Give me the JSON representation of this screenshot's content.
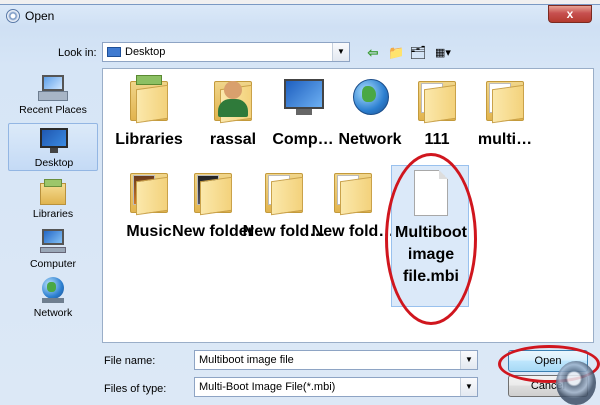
{
  "window": {
    "title": "Open",
    "close_label": "x"
  },
  "toolbar": {
    "look_in_label": "Look in:",
    "look_in_value": "Desktop",
    "view_menu_glyph": "▦▾"
  },
  "places": [
    {
      "label": "Recent Places",
      "icon": "recent-places-icon"
    },
    {
      "label": "Desktop",
      "icon": "desktop-icon",
      "selected": true
    },
    {
      "label": "Libraries",
      "icon": "libraries-icon"
    },
    {
      "label": "Computer",
      "icon": "computer-icon"
    },
    {
      "label": "Network",
      "icon": "network-icon"
    }
  ],
  "files": [
    {
      "label": "Libraries",
      "icon": "libraries-folder-icon"
    },
    {
      "label": "rassal",
      "icon": "user-folder-icon"
    },
    {
      "label": "Comp…",
      "icon": "computer-icon"
    },
    {
      "label": "Network",
      "icon": "network-globe-icon"
    },
    {
      "label": "111",
      "icon": "folder-icon"
    },
    {
      "label": "multi…",
      "icon": "folder-icon"
    },
    {
      "label": "Music",
      "icon": "music-folder-icon"
    },
    {
      "label": "New folder",
      "icon": "folder-icon"
    },
    {
      "label": "New fold…",
      "icon": "folder-icon"
    },
    {
      "label": "New fold…",
      "icon": "folder-icon"
    },
    {
      "label": "Multiboot image file.mbi",
      "icon": "file-icon",
      "selected": true
    }
  ],
  "bottom": {
    "file_name_label": "File name:",
    "file_name_value": "Multiboot image file",
    "file_type_label": "Files of type:",
    "file_type_value": "Multi-Boot Image File(*.mbi)",
    "open_label": "Open",
    "cancel_label": "Cancel"
  },
  "annotation_color": "#d0161e"
}
